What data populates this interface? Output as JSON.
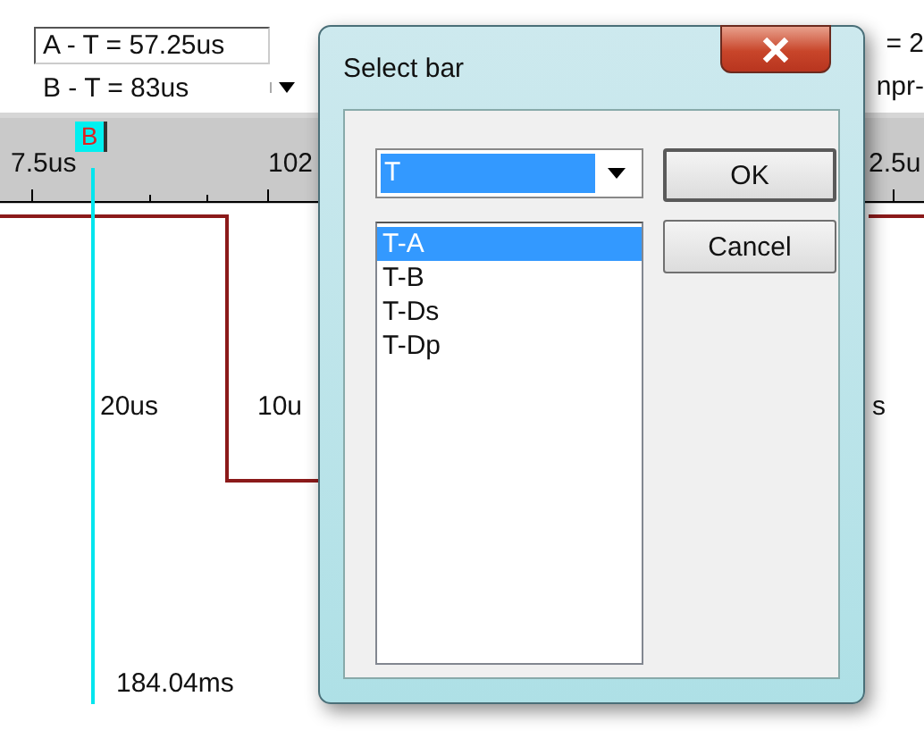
{
  "toolbar": {
    "readouts": [
      {
        "text": "A - T = 57.25us",
        "focused": true
      },
      {
        "text": "B - T = 83us",
        "focused": false
      }
    ],
    "right_texts": [
      "= 2",
      "npr-"
    ]
  },
  "ruler": {
    "labels": [
      "7.5us",
      "102",
      "2.5u"
    ],
    "marker": "B"
  },
  "plot": {
    "labels": [
      "20us",
      "10u",
      "s"
    ],
    "footer": "184.04ms"
  },
  "dialog": {
    "title": "Select bar",
    "combo_value": "T",
    "items": [
      {
        "label": "T-A",
        "selected": true
      },
      {
        "label": "T-B",
        "selected": false
      },
      {
        "label": "T-Ds",
        "selected": false
      },
      {
        "label": "T-Dp",
        "selected": false
      }
    ],
    "buttons": [
      "OK",
      "Cancel"
    ]
  }
}
